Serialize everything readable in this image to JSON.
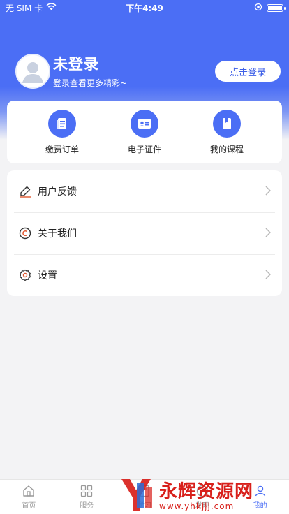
{
  "status_bar": {
    "carrier": "无 SIM 卡",
    "time": "下午4:49"
  },
  "profile": {
    "name": "未登录",
    "subtitle": "登录查看更多精彩~",
    "login_button": "点击登录"
  },
  "quick_actions": [
    {
      "label": "缴费订单",
      "icon": "order-icon"
    },
    {
      "label": "电子证件",
      "icon": "id-card-icon"
    },
    {
      "label": "我的课程",
      "icon": "course-book-icon"
    }
  ],
  "menu": [
    {
      "label": "用户反馈",
      "icon": "pen-icon"
    },
    {
      "label": "关于我们",
      "icon": "copyright-icon"
    },
    {
      "label": "设置",
      "icon": "gear-icon"
    }
  ],
  "tabbar": [
    {
      "label": "首页",
      "icon": "home-icon",
      "active": false
    },
    {
      "label": "服务",
      "icon": "grid-icon",
      "active": false
    },
    {
      "label": "学习",
      "icon": "study-icon",
      "active": false
    },
    {
      "label": "发现",
      "icon": "discover-icon",
      "active": false
    },
    {
      "label": "我的",
      "icon": "user-icon",
      "active": true
    }
  ],
  "watermark": {
    "title": "永辉资源网",
    "url": "www.yhkjjj.com"
  },
  "colors": {
    "primary": "#4b6ef5",
    "background": "#f3f3f5",
    "watermark": "#d8201b"
  }
}
